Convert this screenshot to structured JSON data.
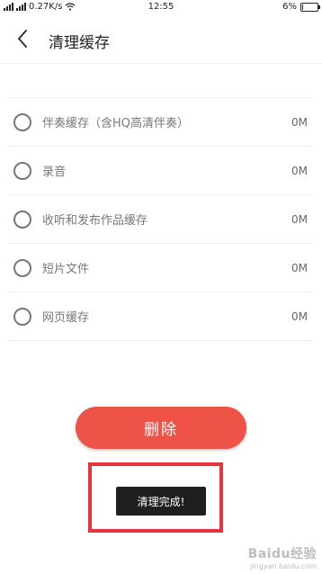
{
  "statusbar": {
    "network_speed": "0.27K/s",
    "time": "12:55",
    "battery": "6%",
    "battery_level": 0.06
  },
  "header": {
    "title": "清理缓存"
  },
  "list": {
    "items": [
      {
        "label": "伴奏缓存（含HQ高清伴奏）",
        "size": "0M"
      },
      {
        "label": "录音",
        "size": "0M"
      },
      {
        "label": "收听和发布作品缓存",
        "size": "0M"
      },
      {
        "label": "短片文件",
        "size": "0M"
      },
      {
        "label": "网页缓存",
        "size": "0M"
      }
    ]
  },
  "actions": {
    "delete_label": "删除"
  },
  "toast": {
    "text": "清理完成!"
  },
  "watermark": {
    "main": "Baidu经验",
    "sub": "jingyan.baidu.com"
  },
  "colors": {
    "accent": "#ef5246",
    "highlight": "#e8343a",
    "toast_bg": "#1f1f1f"
  }
}
